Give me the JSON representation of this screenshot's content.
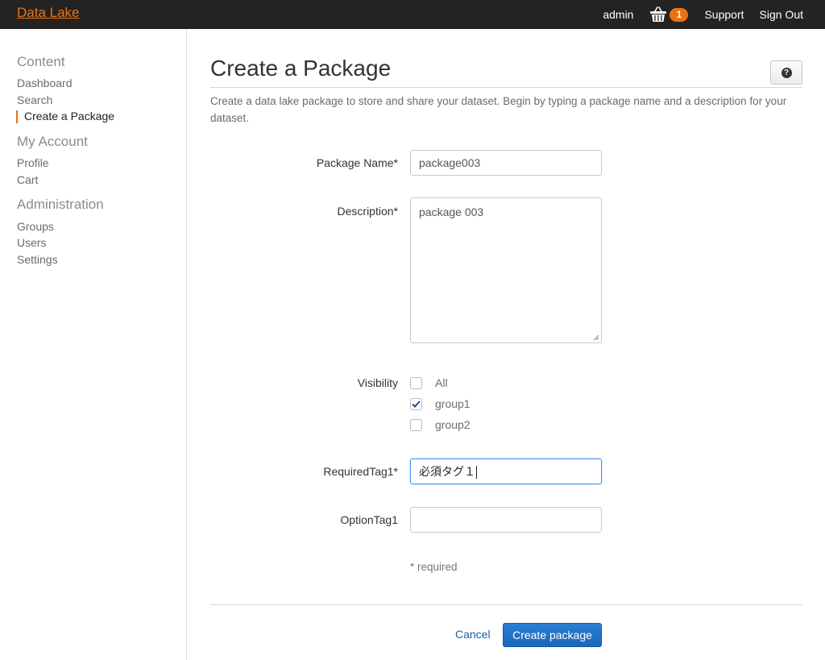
{
  "header": {
    "brand": "Data Lake",
    "user": "admin",
    "cart_count": "1",
    "support_label": "Support",
    "signout_label": "Sign Out"
  },
  "sidebar": {
    "sections": [
      {
        "title": "Content",
        "items": [
          "Dashboard",
          "Search",
          "Create a Package"
        ]
      },
      {
        "title": "My Account",
        "items": [
          "Profile",
          "Cart"
        ]
      },
      {
        "title": "Administration",
        "items": [
          "Groups",
          "Users",
          "Settings"
        ]
      }
    ],
    "active_item": "Create a Package"
  },
  "page": {
    "title": "Create a Package",
    "help_icon": "question-circle-icon",
    "intro": "Create a data lake package to store and share your dataset. Begin by typing a package name and a description for your dataset."
  },
  "form": {
    "package_name_label": "Package Name*",
    "package_name_value": "package003",
    "description_label": "Description*",
    "description_value": "package 003",
    "visibility_label": "Visibility",
    "visibility_options": [
      {
        "label": "All",
        "checked": false
      },
      {
        "label": "group1",
        "checked": true
      },
      {
        "label": "group2",
        "checked": false
      }
    ],
    "required_tag_label": "RequiredTag1*",
    "required_tag_value": "必須タグ１",
    "option_tag_label": "OptionTag1",
    "option_tag_value": "",
    "required_note": "* required"
  },
  "actions": {
    "cancel_label": "Cancel",
    "create_label": "Create package"
  },
  "colors": {
    "accent": "#ec7211",
    "topbar": "#232323",
    "primary_button": "#1c66b9"
  }
}
